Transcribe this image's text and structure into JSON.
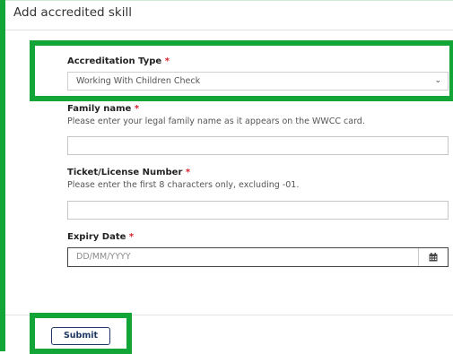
{
  "dialog": {
    "title": "Add accredited skill"
  },
  "form": {
    "accreditation_type": {
      "label": "Accreditation Type",
      "required_mark": "*",
      "value": "Working With Children Check"
    },
    "family_name": {
      "label": "Family name",
      "required_mark": "*",
      "help": "Please enter your legal family name as it appears on the WWCC card.",
      "value": ""
    },
    "ticket_number": {
      "label": "Ticket/License Number",
      "required_mark": "*",
      "help": "Please enter the first 8 characters only, excluding -01.",
      "value": ""
    },
    "expiry_date": {
      "label": "Expiry Date",
      "required_mark": "*",
      "placeholder": "DD/MM/YYYY"
    }
  },
  "footer": {
    "submit_label": "Submit"
  },
  "icons": {
    "type_dropdown": "chevron-down-icon",
    "date_picker": "calendar-icon"
  },
  "colors": {
    "highlight": "#13a538",
    "required": "#d9232e",
    "button": "#1f3864"
  }
}
